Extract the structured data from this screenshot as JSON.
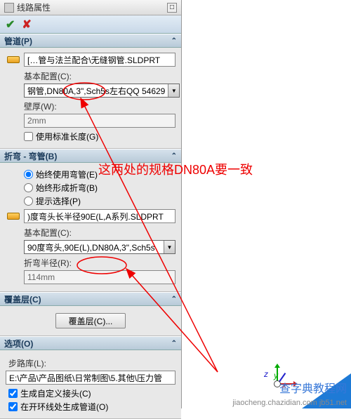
{
  "header": {
    "title": "线路属性"
  },
  "actions": {
    "ok": "✔",
    "cancel": "✘"
  },
  "pipe": {
    "title": "管道(P)",
    "file": "[…管与法兰配合\\无缝钢管.SLDPRT",
    "config_label": "基本配置(C):",
    "config_value": "钢管,DN80A,3\",Sch5s左右QQ 54629",
    "thickness_label": "壁厚(W):",
    "thickness_value": "2mm",
    "use_std": "使用标准长度(G)"
  },
  "bend": {
    "title": "折弯 - 弯管(B)",
    "r1": "始终使用弯管(E)",
    "r2": "始终形成折弯(B)",
    "r3": "提示选择(P)",
    "file": ")度弯头长半径90E(L,A系列.SLDPRT",
    "config_label": "基本配置(C):",
    "config_value": "90度弯头,90E(L),DN80A,3\",Sch5s",
    "radius_label": "折弯半径(R):",
    "radius_value": "114mm"
  },
  "cover": {
    "title": "覆盖层(C)",
    "btn": "覆盖层(C)..."
  },
  "options": {
    "title": "选项(O)",
    "lib_label": "步路库(L):",
    "lib_value": "E:\\产品\\产品图纸\\日常制图\\5.其他\\压力管",
    "c1": "生成自定义接头(C)",
    "c2": "在开环线处生成管道(O)"
  },
  "annotation": "这两处的规格DN80A要一致",
  "axes": {
    "x": "x",
    "y": "y",
    "z": "z"
  },
  "watermark": {
    "site": "查字典教程网",
    "url": "jiaocheng.chazidian.com  jb51.net"
  }
}
